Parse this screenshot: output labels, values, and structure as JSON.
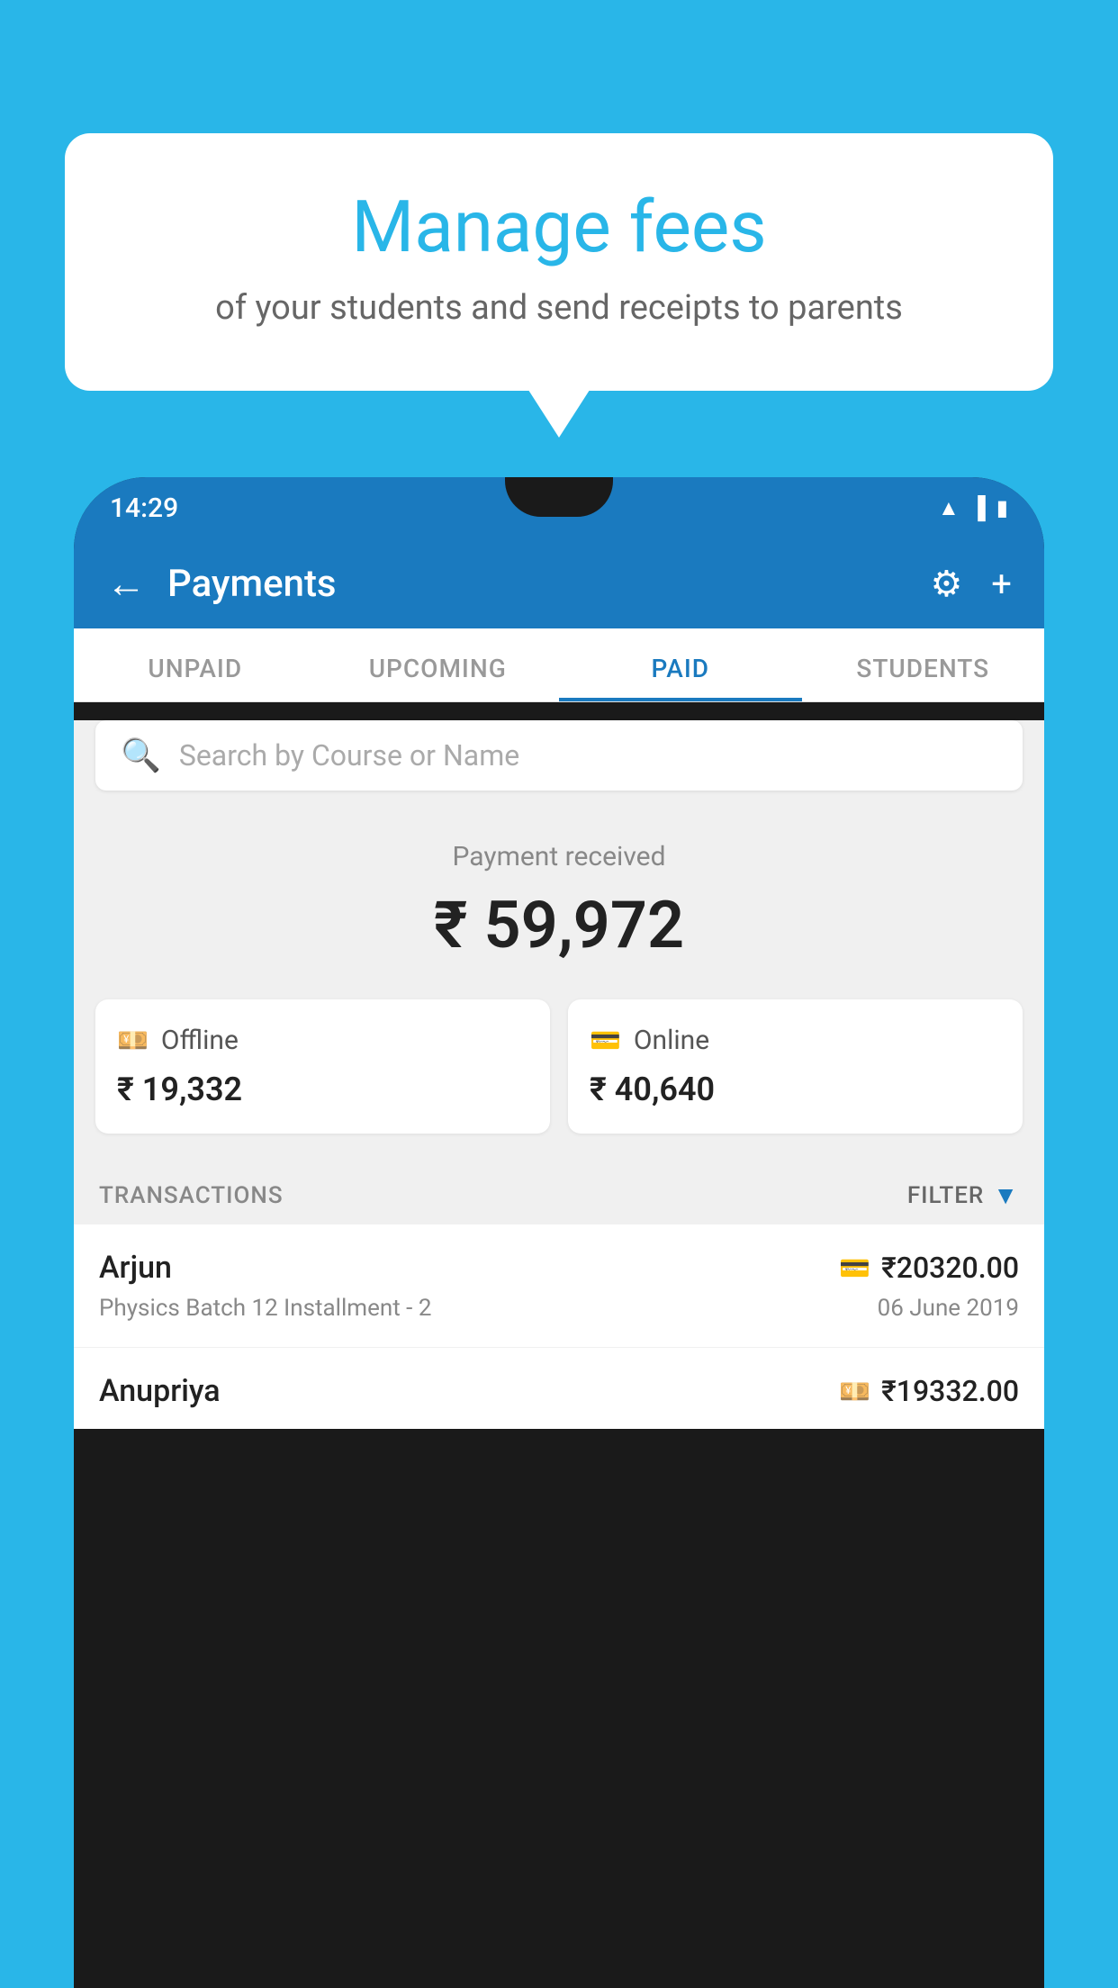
{
  "background_color": "#29b6e8",
  "speech_bubble": {
    "title": "Manage fees",
    "subtitle": "of your students and send receipts to parents"
  },
  "status_bar": {
    "time": "14:29",
    "icons": [
      "wifi",
      "signal",
      "battery"
    ]
  },
  "header": {
    "title": "Payments",
    "back_label": "←",
    "settings_label": "⚙",
    "add_label": "+"
  },
  "tabs": [
    {
      "label": "UNPAID",
      "active": false
    },
    {
      "label": "UPCOMING",
      "active": false
    },
    {
      "label": "PAID",
      "active": true
    },
    {
      "label": "STUDENTS",
      "active": false
    }
  ],
  "search": {
    "placeholder": "Search by Course or Name"
  },
  "payment_section": {
    "label": "Payment received",
    "amount": "₹ 59,972"
  },
  "cards": [
    {
      "icon": "offline",
      "label": "Offline",
      "amount": "₹ 19,332"
    },
    {
      "icon": "online",
      "label": "Online",
      "amount": "₹ 40,640"
    }
  ],
  "transactions_section": {
    "label": "TRANSACTIONS",
    "filter_label": "FILTER"
  },
  "transactions": [
    {
      "name": "Arjun",
      "type_icon": "card",
      "amount": "₹20320.00",
      "description": "Physics Batch 12 Installment - 2",
      "date": "06 June 2019"
    },
    {
      "name": "Anupriya",
      "type_icon": "cash",
      "amount": "₹19332.00",
      "description": "",
      "date": ""
    }
  ]
}
